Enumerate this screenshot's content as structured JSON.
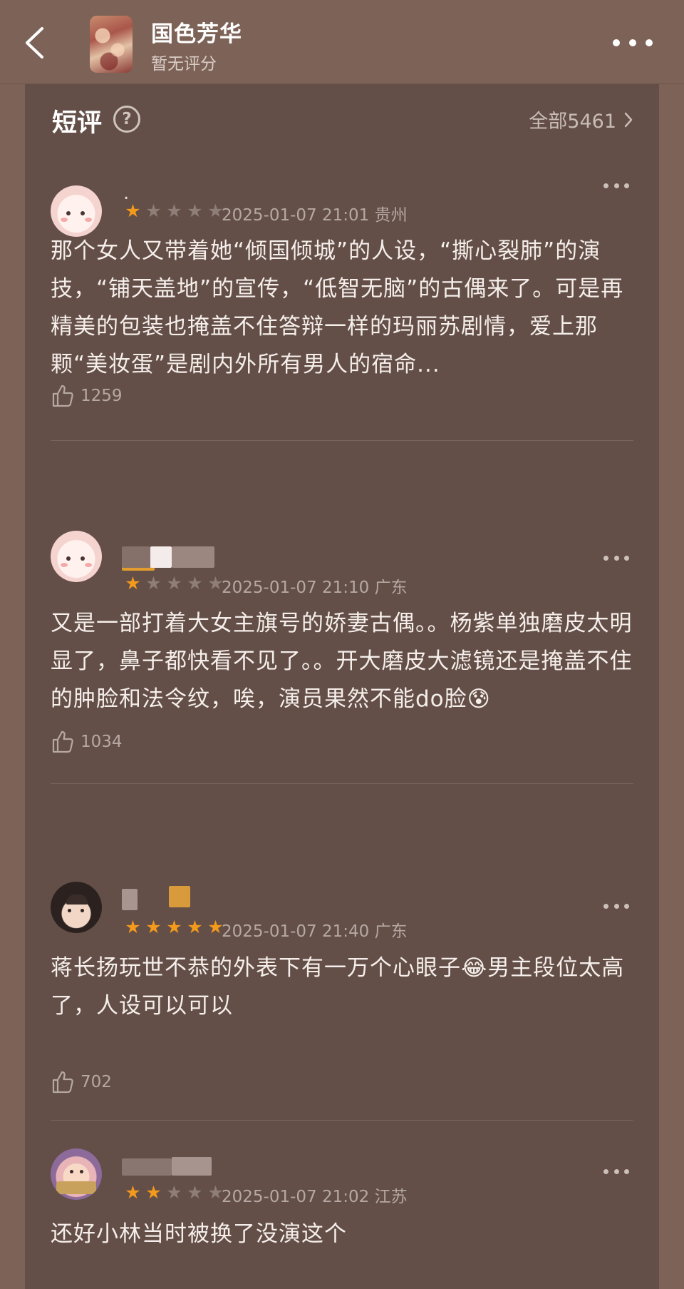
{
  "header": {
    "title": "国色芳华",
    "subtitle": "暂无评分"
  },
  "section": {
    "title": "短评",
    "all_label": "全部5461"
  },
  "reviews": [
    {
      "nickname": ".",
      "stars": 1,
      "timestamp": "2025-01-07 21:01",
      "location": "贵州",
      "text": "那个女人又带着她“倾国倾城”的人设，“撕心裂肺”的演技，“铺天盖地”的宣传，“低智无脑”的古偶来了。可是再精美的包装也掩盖不住答辩一样的玛丽苏剧情，爱上那颗“美妆蛋”是剧内外所有男人的宿命...",
      "likes": "1259"
    },
    {
      "nickname": "",
      "stars": 1,
      "timestamp": "2025-01-07 21:10",
      "location": "广东",
      "text": "又是一部打着大女主旗号的娇妻古偶。。杨紫单独磨皮太明显了，鼻子都快看不见了。。开大磨皮大滤镜还是掩盖不住的肿脸和法令纹，唉，演员果然不能do脸😰",
      "likes": "1034"
    },
    {
      "nickname": "",
      "stars": 5,
      "timestamp": "2025-01-07 21:40",
      "location": "广东",
      "text": "蒋长扬玩世不恭的外表下有一万个心眼子😂男主段位太高了，人设可以可以",
      "likes": "702"
    },
    {
      "nickname": "",
      "stars": 2,
      "timestamp": "2025-01-07 21:02",
      "location": "江苏",
      "text": "还好小林当时被换了没演这个",
      "likes": ""
    }
  ]
}
